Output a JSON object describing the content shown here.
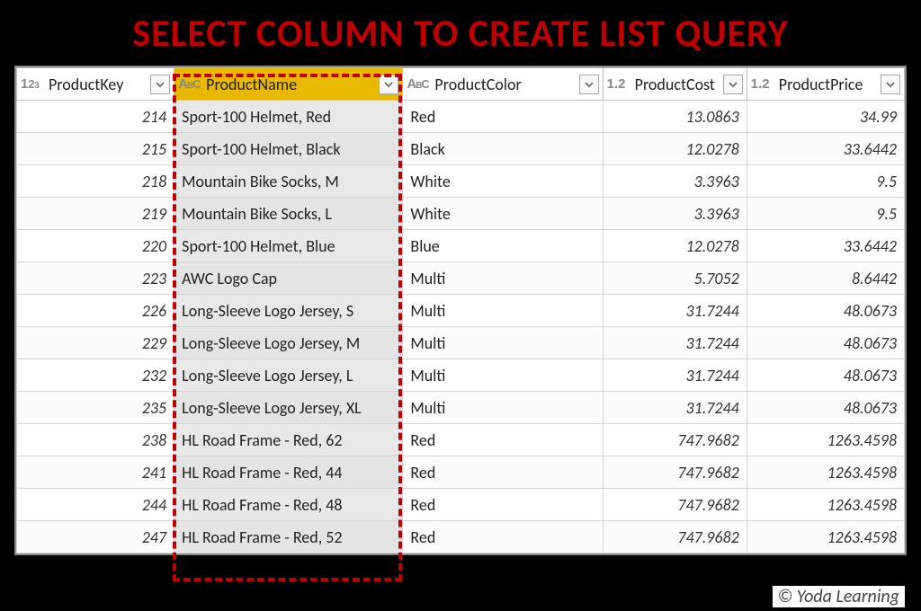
{
  "banner": "SELECT COLUMN TO CREATE LIST QUERY",
  "credit": "© Yoda Learning",
  "columns": [
    {
      "label": "ProductKey",
      "type": "int",
      "selected": false,
      "numeric": true
    },
    {
      "label": "ProductName",
      "type": "text",
      "selected": true,
      "numeric": false
    },
    {
      "label": "ProductColor",
      "type": "text",
      "selected": false,
      "numeric": false
    },
    {
      "label": "ProductCost",
      "type": "dec",
      "selected": false,
      "numeric": true
    },
    {
      "label": "ProductPrice",
      "type": "dec",
      "selected": false,
      "numeric": true
    }
  ],
  "rows": [
    {
      "ProductKey": 214,
      "ProductName": "Sport-100 Helmet, Red",
      "ProductColor": "Red",
      "ProductCost": "13.0863",
      "ProductPrice": "34.99"
    },
    {
      "ProductKey": 215,
      "ProductName": "Sport-100 Helmet, Black",
      "ProductColor": "Black",
      "ProductCost": "12.0278",
      "ProductPrice": "33.6442"
    },
    {
      "ProductKey": 218,
      "ProductName": "Mountain Bike Socks, M",
      "ProductColor": "White",
      "ProductCost": "3.3963",
      "ProductPrice": "9.5"
    },
    {
      "ProductKey": 219,
      "ProductName": "Mountain Bike Socks, L",
      "ProductColor": "White",
      "ProductCost": "3.3963",
      "ProductPrice": "9.5"
    },
    {
      "ProductKey": 220,
      "ProductName": "Sport-100 Helmet, Blue",
      "ProductColor": "Blue",
      "ProductCost": "12.0278",
      "ProductPrice": "33.6442"
    },
    {
      "ProductKey": 223,
      "ProductName": "AWC Logo Cap",
      "ProductColor": "Multi",
      "ProductCost": "5.7052",
      "ProductPrice": "8.6442"
    },
    {
      "ProductKey": 226,
      "ProductName": "Long-Sleeve Logo Jersey, S",
      "ProductColor": "Multi",
      "ProductCost": "31.7244",
      "ProductPrice": "48.0673"
    },
    {
      "ProductKey": 229,
      "ProductName": "Long-Sleeve Logo Jersey, M",
      "ProductColor": "Multi",
      "ProductCost": "31.7244",
      "ProductPrice": "48.0673"
    },
    {
      "ProductKey": 232,
      "ProductName": "Long-Sleeve Logo Jersey, L",
      "ProductColor": "Multi",
      "ProductCost": "31.7244",
      "ProductPrice": "48.0673"
    },
    {
      "ProductKey": 235,
      "ProductName": "Long-Sleeve Logo Jersey, XL",
      "ProductColor": "Multi",
      "ProductCost": "31.7244",
      "ProductPrice": "48.0673"
    },
    {
      "ProductKey": 238,
      "ProductName": "HL Road Frame - Red, 62",
      "ProductColor": "Red",
      "ProductCost": "747.9682",
      "ProductPrice": "1263.4598"
    },
    {
      "ProductKey": 241,
      "ProductName": "HL Road Frame - Red, 44",
      "ProductColor": "Red",
      "ProductCost": "747.9682",
      "ProductPrice": "1263.4598"
    },
    {
      "ProductKey": 244,
      "ProductName": "HL Road Frame - Red, 48",
      "ProductColor": "Red",
      "ProductCost": "747.9682",
      "ProductPrice": "1263.4598"
    },
    {
      "ProductKey": 247,
      "ProductName": "HL Road Frame - Red, 52",
      "ProductColor": "Red",
      "ProductCost": "747.9682",
      "ProductPrice": "1263.4598"
    }
  ]
}
